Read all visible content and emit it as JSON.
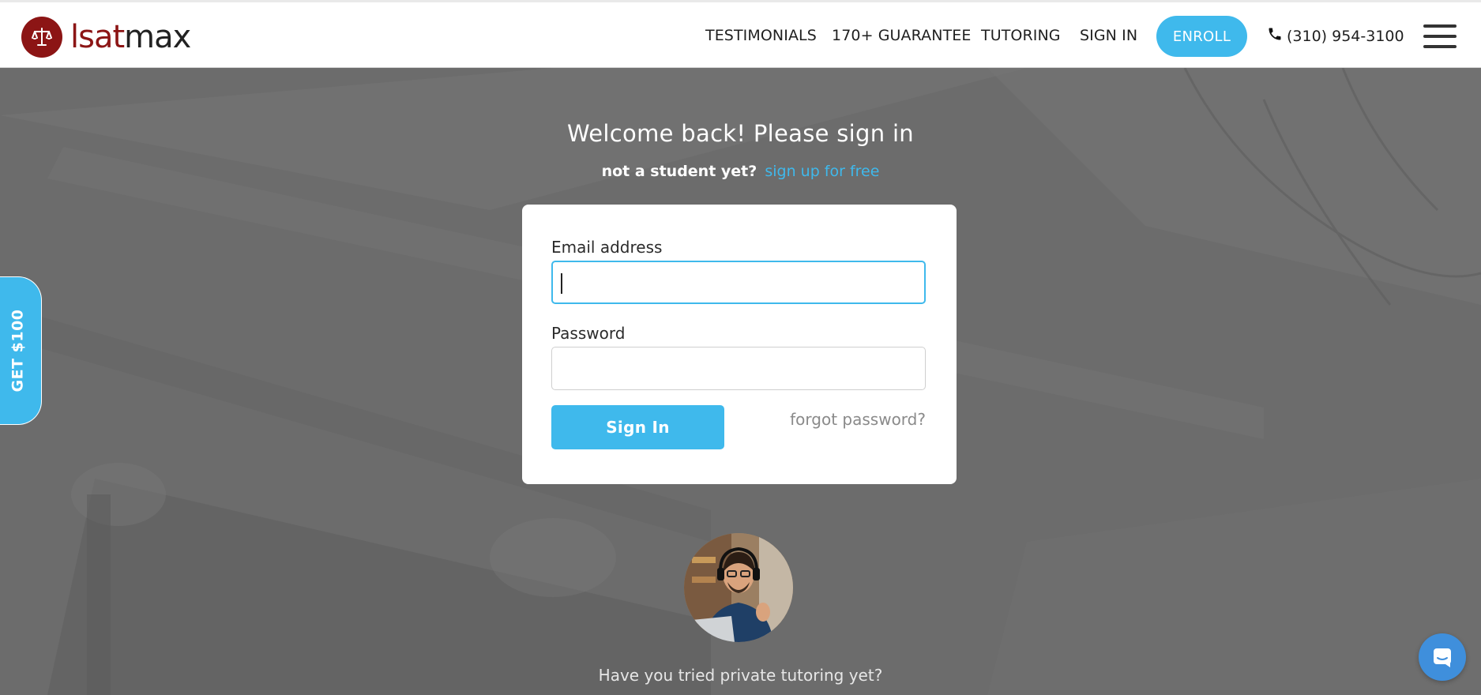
{
  "header": {
    "logo_text_red": "lsat",
    "logo_text_dark": "max",
    "nav": {
      "testimonials": "TESTIMONIALS",
      "guarantee": "170+ GUARANTEE",
      "tutoring": "TUTORING",
      "signin": "SIGN IN"
    },
    "enroll_label": "ENROLL",
    "phone": "(310) 954-3100"
  },
  "side_tab": {
    "label": "GET $100"
  },
  "main": {
    "welcome_title": "Welcome back! Please sign in",
    "not_student_text": "not a student yet?",
    "signup_link": "sign up for free"
  },
  "form": {
    "email_label": "Email address",
    "email_value": "",
    "password_label": "Password",
    "password_value": "",
    "signin_button": "Sign In",
    "forgot_link": "forgot password?"
  },
  "tutoring": {
    "question": "Have you tried private tutoring yet?"
  },
  "colors": {
    "accent": "#3fb9ec",
    "brand_red": "#8c1515",
    "overlay": "#6d6d6d",
    "chat": "#3f8fdc"
  },
  "icons": [
    "scales-icon",
    "phone-icon",
    "menu-icon",
    "chat-icon"
  ]
}
